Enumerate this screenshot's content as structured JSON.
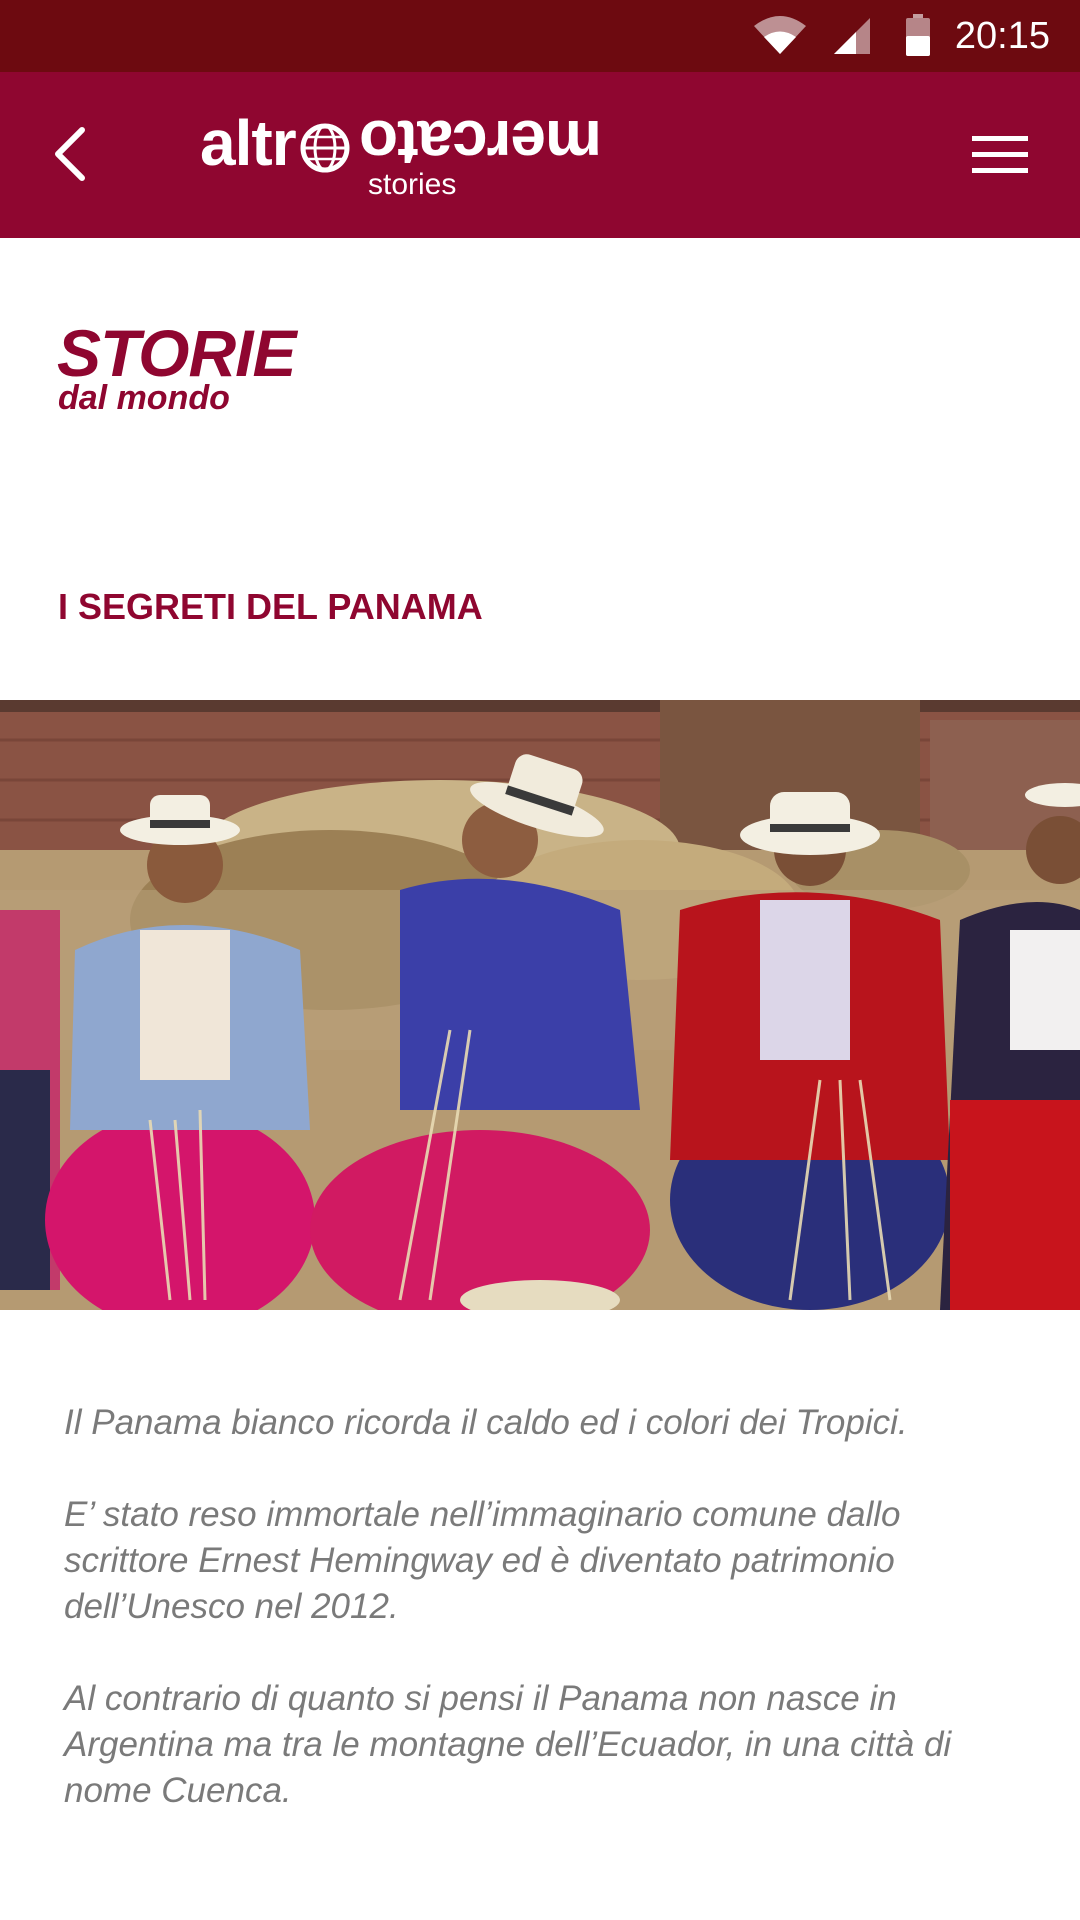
{
  "status_bar": {
    "time": "20:15",
    "icons": [
      "wifi-icon",
      "cell-signal-icon",
      "battery-icon"
    ]
  },
  "app_bar": {
    "logo": {
      "word_part1": "altr",
      "word_part2": "mercato",
      "subtitle": "stories"
    },
    "back_icon": "chevron-left-icon",
    "menu_icon": "hamburger-menu-icon"
  },
  "section": {
    "title": "STORIE",
    "subtitle": "dal mondo"
  },
  "article": {
    "title": "I SEGRETI DEL PANAMA",
    "paragraphs": [
      "Il Panama bianco ricorda il caldo ed i colori dei Tropici.",
      "E’ stato reso immortale nell’immaginario comune dallo scrittore Ernest Hemingway ed è diventato patrimonio dell’Unesco nel 2012.",
      "Al contrario di quanto si pensi il Panama non nasce in Argentina ma tra le montagne dell’Ecuador, in una città di nome Cuenca."
    ]
  },
  "colors": {
    "status_bar": "#6d0a10",
    "app_bar": "#8f0630",
    "accent_text": "#8f0630",
    "body_text": "#7a7a7a"
  }
}
